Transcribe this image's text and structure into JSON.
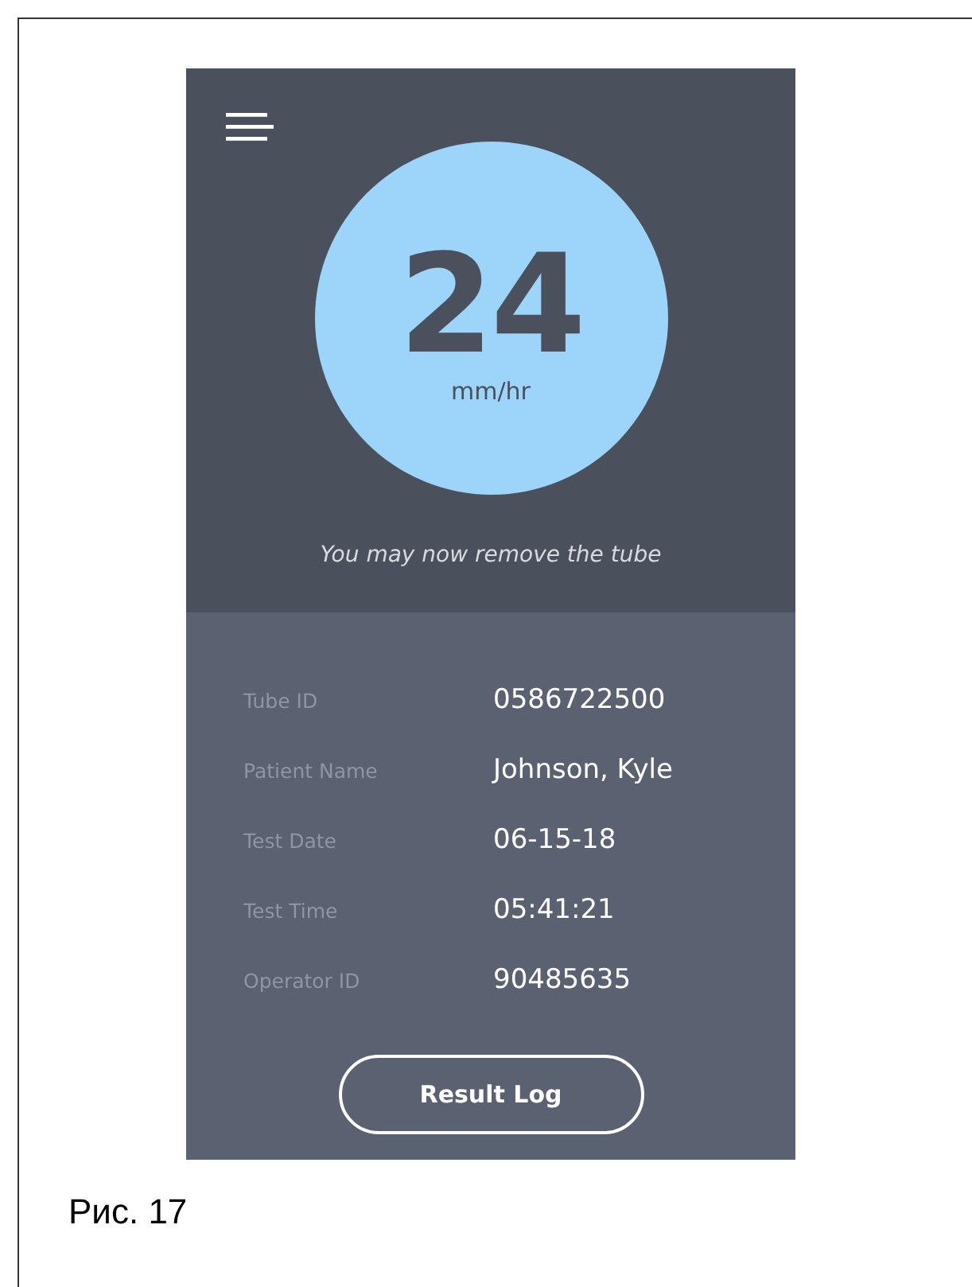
{
  "screen": {
    "result": {
      "value": "24",
      "unit": "mm/hr"
    },
    "message": "You may now remove the tube",
    "details": [
      {
        "label": "Tube ID",
        "value": "0586722500"
      },
      {
        "label": "Patient Name",
        "value": "Johnson, Kyle"
      },
      {
        "label": "Test Date",
        "value": "06-15-18"
      },
      {
        "label": "Test Time",
        "value": "05:41:21"
      },
      {
        "label": "Operator ID",
        "value": "90485635"
      }
    ],
    "button": "Result Log"
  },
  "caption": "Рис. 17"
}
